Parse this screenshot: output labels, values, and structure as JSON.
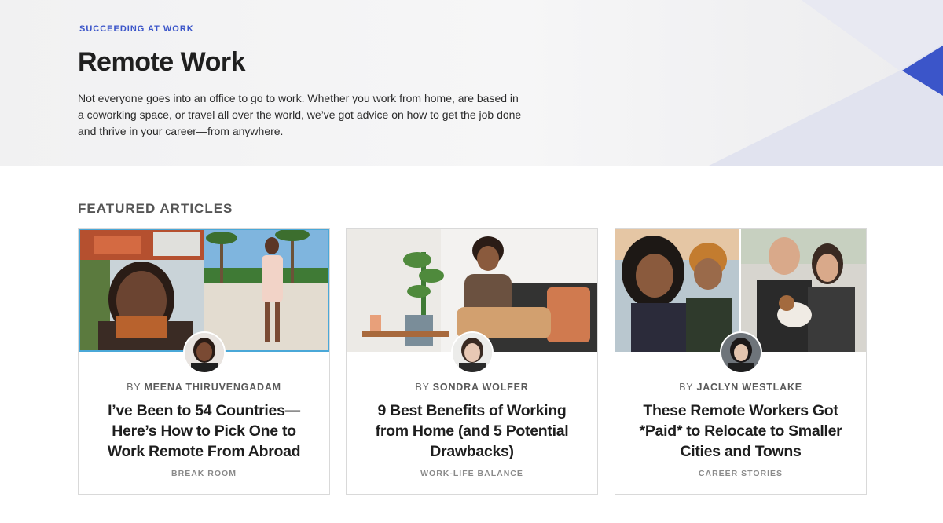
{
  "hero": {
    "eyebrow": "SUCCEEDING AT WORK",
    "title": "Remote Work",
    "description": "Not everyone goes into an office to go to work. Whether you work from home, are based in a coworking space, or travel all over the world, we’ve got advice on how to get the job done and thrive in your career—from anywhere.",
    "accent_color": "#3b55c9"
  },
  "featured": {
    "heading": "FEATURED ARTICLES",
    "articles": [
      {
        "by": "BY",
        "author": "MEENA THIRUVENGADAM",
        "title": "I’ve Been to 54 Countries—Here’s How to Pick One to Work Remote From Abroad",
        "category": "BREAK ROOM"
      },
      {
        "by": "BY",
        "author": "SONDRA WOLFER",
        "title": "9 Best Benefits of Working from Home (and 5 Potential Drawbacks)",
        "category": "WORK-LIFE BALANCE"
      },
      {
        "by": "BY",
        "author": "JACLYN WESTLAKE",
        "title": "These Remote Workers Got *Paid* to Relocate to Smaller Cities and Towns",
        "category": "CAREER STORIES"
      }
    ]
  }
}
